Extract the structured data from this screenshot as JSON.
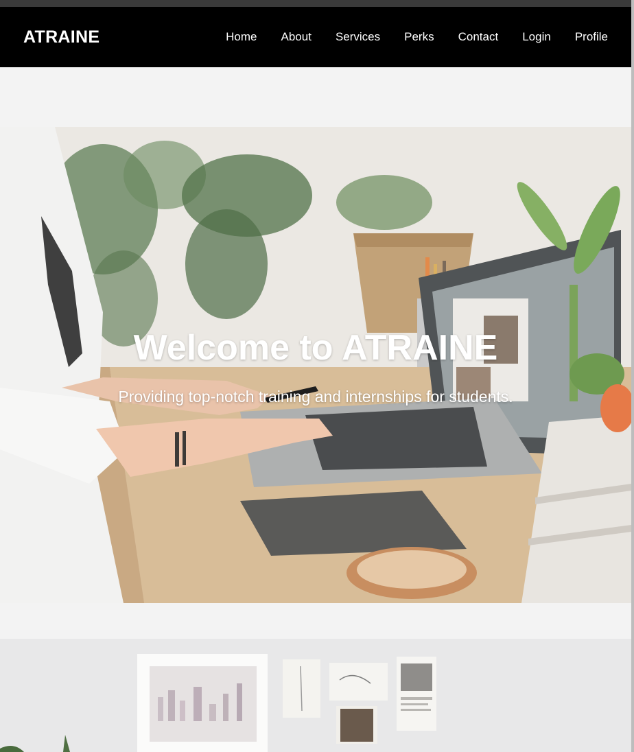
{
  "nav": {
    "brand": "ATRAINE",
    "links": [
      "Home",
      "About",
      "Services",
      "Perks",
      "Contact",
      "Login",
      "Profile"
    ]
  },
  "hero": {
    "title": "Welcome to ATRAINE",
    "subtitle": "Providing top-notch training and internships for students."
  },
  "colors": {
    "navbar_bg": "#000000",
    "page_bg": "#f3f3f3",
    "text_on_dark": "#ffffff"
  }
}
